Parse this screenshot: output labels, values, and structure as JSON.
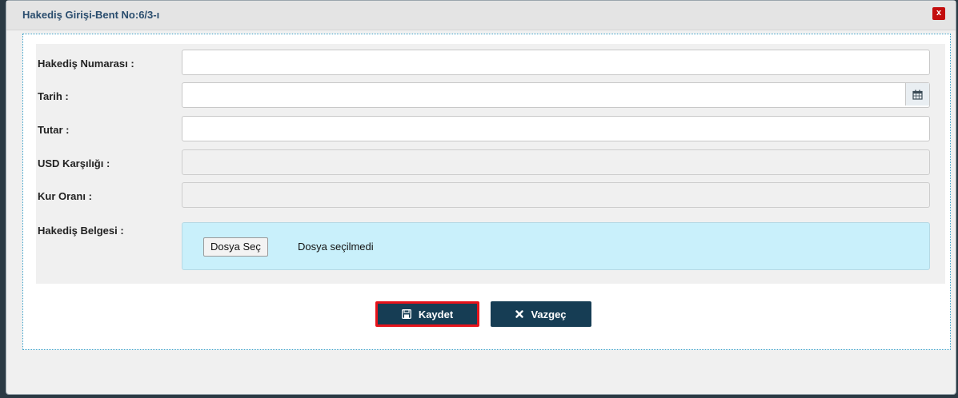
{
  "dialog": {
    "title": "Hakediş Girişi-Bent No:6/3-ı",
    "close_label": "x"
  },
  "form": {
    "fields": [
      {
        "label": "Hakediş Numarası :",
        "value": "",
        "readonly": false
      },
      {
        "label": "Tarih :",
        "value": "",
        "readonly": false,
        "icon": "calendar-icon"
      },
      {
        "label": "Tutar :",
        "value": "",
        "readonly": false
      },
      {
        "label": "USD Karşılığı :",
        "value": "",
        "readonly": true
      },
      {
        "label": "Kur Oranı :",
        "value": "",
        "readonly": true
      }
    ],
    "file": {
      "label": "Hakediş Belgesi :",
      "button_label": "Dosya Seç",
      "status": "Dosya seçilmedi"
    }
  },
  "actions": {
    "save_label": "Kaydet",
    "save_icon": "floppy-disk-icon",
    "cancel_label": "Vazgeç",
    "cancel_icon": "times-icon"
  },
  "colors": {
    "title_text": "#2a4d6e",
    "close_bg": "#c30d0d",
    "button_bg": "#163d54",
    "save_highlight": "#e6131b",
    "file_box_bg": "#c9f0fb"
  }
}
